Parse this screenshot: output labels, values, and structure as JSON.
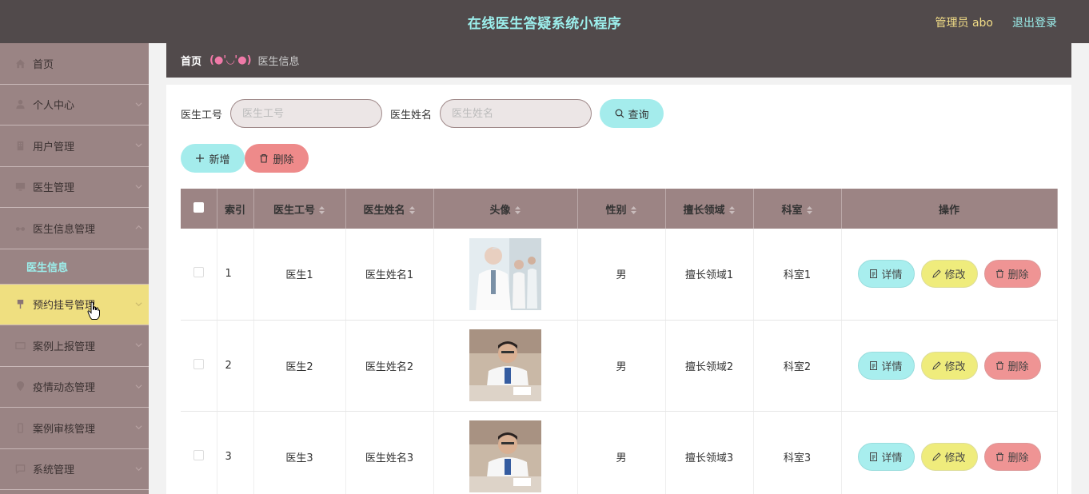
{
  "header": {
    "title": "在线医生答疑系统小程序",
    "admin": "管理员 abo",
    "logout": "退出登录"
  },
  "sidebar": {
    "items": [
      {
        "label": "首页",
        "icon": "home-icon"
      },
      {
        "label": "个人中心",
        "icon": "user-icon"
      },
      {
        "label": "用户管理",
        "icon": "building-icon"
      },
      {
        "label": "医生管理",
        "icon": "monitor-icon"
      },
      {
        "label": "医生信息管理",
        "icon": "glasses-icon"
      },
      {
        "label": "医生信息",
        "icon": ""
      },
      {
        "label": "预约挂号管理",
        "icon": "pin-icon"
      },
      {
        "label": "案例上报管理",
        "icon": "card-icon"
      },
      {
        "label": "疫情动态管理",
        "icon": "location-icon"
      },
      {
        "label": "案例审核管理",
        "icon": "phone-icon"
      },
      {
        "label": "系统管理",
        "icon": "message-icon"
      }
    ]
  },
  "breadcrumb": {
    "home": "首页",
    "separator": "(●'◡'●)",
    "current": "医生信息"
  },
  "search": {
    "id_label": "医生工号",
    "id_placeholder": "医生工号",
    "name_label": "医生姓名",
    "name_placeholder": "医生姓名",
    "query_button": "查询"
  },
  "actions": {
    "add": "新增",
    "delete": "删除"
  },
  "table": {
    "columns": [
      "索引",
      "医生工号",
      "医生姓名",
      "头像",
      "性别",
      "擅长领域",
      "科室",
      "操作"
    ],
    "rows": [
      {
        "index": "1",
        "id": "医生1",
        "name": "医生姓名1",
        "gender": "男",
        "field": "擅长领域1",
        "dept": "科室1"
      },
      {
        "index": "2",
        "id": "医生2",
        "name": "医生姓名2",
        "gender": "男",
        "field": "擅长领域2",
        "dept": "科室2"
      },
      {
        "index": "3",
        "id": "医生3",
        "name": "医生姓名3",
        "gender": "男",
        "field": "擅长领域3",
        "dept": "科室3"
      }
    ],
    "row_actions": {
      "detail": "详情",
      "edit": "修改",
      "delete": "删除"
    }
  },
  "colors": {
    "header_bg": "#514a4b",
    "sidebar_bg": "#9a8484",
    "accent_cyan": "#9cefec",
    "active_yellow": "#efdf80",
    "danger": "#ee8a8a"
  }
}
